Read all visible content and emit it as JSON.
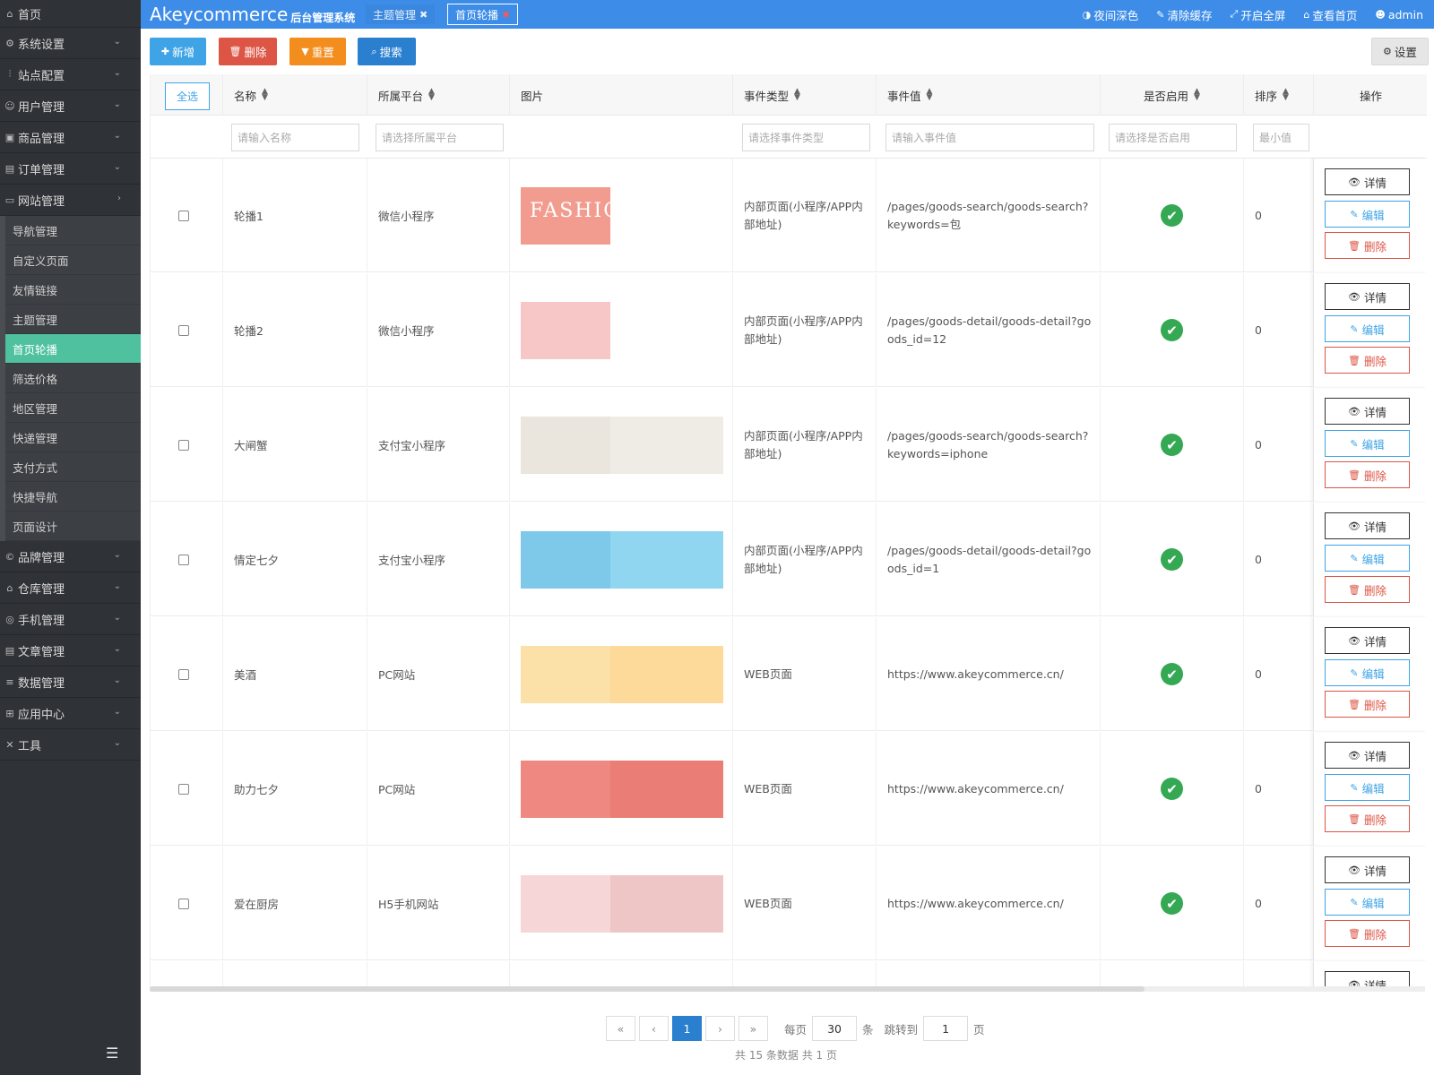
{
  "sidebar": {
    "home": "首页",
    "items_before": [
      {
        "label": "系统设置",
        "icon": "gear-icon",
        "glyph": "⚙"
      },
      {
        "label": "站点配置",
        "icon": "sliders-icon",
        "glyph": "⫶"
      },
      {
        "label": "用户管理",
        "icon": "user-icon",
        "glyph": "☺"
      },
      {
        "label": "商品管理",
        "icon": "box-icon",
        "glyph": "▣"
      },
      {
        "label": "订单管理",
        "icon": "list-icon",
        "glyph": "▤"
      },
      {
        "label": "网站管理",
        "icon": "monitor-icon",
        "glyph": "▭"
      }
    ],
    "submenu": [
      "导航管理",
      "自定义页面",
      "友情链接",
      "主题管理",
      "首页轮播",
      "筛选价格",
      "地区管理",
      "快递管理",
      "支付方式",
      "快捷导航",
      "页面设计"
    ],
    "active_sub": "首页轮播",
    "items_after": [
      {
        "label": "品牌管理",
        "icon": "copyright-icon",
        "glyph": "©"
      },
      {
        "label": "仓库管理",
        "icon": "warehouse-icon",
        "glyph": "⌂"
      },
      {
        "label": "手机管理",
        "icon": "mobile-icon",
        "glyph": "◎"
      },
      {
        "label": "文章管理",
        "icon": "article-icon",
        "glyph": "▤"
      },
      {
        "label": "数据管理",
        "icon": "database-icon",
        "glyph": "≡"
      },
      {
        "label": "应用中心",
        "icon": "apps-icon",
        "glyph": "⊞"
      },
      {
        "label": "工具",
        "icon": "tools-icon",
        "glyph": "✕"
      }
    ]
  },
  "topbar": {
    "brand": "Akeycommerce",
    "brand_sub": "后台管理系统",
    "tabs": [
      {
        "label": "主题管理"
      },
      {
        "label": "首页轮播"
      }
    ],
    "actions": [
      {
        "label": "夜间深色",
        "icon": "contrast-icon",
        "glyph": "◑"
      },
      {
        "label": "清除缓存",
        "icon": "brush-icon",
        "glyph": "✎"
      },
      {
        "label": "开启全屏",
        "icon": "fullscreen-icon",
        "glyph": "⤢"
      },
      {
        "label": "查看首页",
        "icon": "home-icon",
        "glyph": "⌂"
      },
      {
        "label": "admin",
        "icon": "user-icon",
        "glyph": "☻"
      }
    ]
  },
  "toolbar": {
    "add": "新增",
    "delete": "删除",
    "reset": "重置",
    "search": "搜索",
    "settings": "设置"
  },
  "table": {
    "select_all": "全选",
    "columns": {
      "name": "名称",
      "platform": "所属平台",
      "image": "图片",
      "event_type": "事件类型",
      "event_value": "事件值",
      "enabled": "是否启用",
      "sort": "排序",
      "ops": "操作"
    },
    "filters": {
      "name": "请输入名称",
      "platform": "请选择所属平台",
      "event_type": "请选择事件类型",
      "event_value": "请输入事件值",
      "enabled": "请选择是否启用",
      "sort_min": "最小值"
    },
    "op_labels": {
      "detail": "详情",
      "edit": "编辑",
      "delete": "删除"
    },
    "rows": [
      {
        "name": "轮播1",
        "platform": "微信小程序",
        "event_type": "内部页面(小程序/APP内部地址)",
        "event_value": "/pages/goods-search/goods-search?keywords=包",
        "sort": "0",
        "image_text": "FASHION",
        "img_color": "#f29c8f",
        "img_bg": "#f29c8f",
        "img_full": false
      },
      {
        "name": "轮播2",
        "platform": "微信小程序",
        "event_type": "内部页面(小程序/APP内部地址)",
        "event_value": "/pages/goods-detail/goods-detail?goods_id=12",
        "sort": "0",
        "image_text": "",
        "img_color": "#f7c6c6",
        "img_bg": "#f7c6c6",
        "img_full": false
      },
      {
        "name": "大闸蟹",
        "platform": "支付宝小程序",
        "event_type": "内部页面(小程序/APP内部地址)",
        "event_value": "/pages/goods-search/goods-search?keywords=iphone",
        "sort": "0",
        "image_text": "",
        "img_color": "#e9e4dc",
        "img_bg": "#efece6",
        "img_full": true
      },
      {
        "name": "情定七夕",
        "platform": "支付宝小程序",
        "event_type": "内部页面(小程序/APP内部地址)",
        "event_value": "/pages/goods-detail/goods-detail?goods_id=1",
        "sort": "0",
        "image_text": "",
        "img_color": "#7cc6e8",
        "img_bg": "#91d6f0",
        "img_full": true
      },
      {
        "name": "美酒",
        "platform": "PC网站",
        "event_type": "WEB页面",
        "event_value": "https://www.akeycommerce.cn/",
        "sort": "0",
        "image_text": "",
        "img_color": "#fbe0a9",
        "img_bg": "#fdd99a",
        "img_full": true
      },
      {
        "name": "助力七夕",
        "platform": "PC网站",
        "event_type": "WEB页面",
        "event_value": "https://www.akeycommerce.cn/",
        "sort": "0",
        "image_text": "",
        "img_color": "#ef8a82",
        "img_bg": "#ea7e76",
        "img_full": true
      },
      {
        "name": "爱在厨房",
        "platform": "H5手机网站",
        "event_type": "WEB页面",
        "event_value": "https://www.akeycommerce.cn/",
        "sort": "0",
        "image_text": "",
        "img_color": "#f6d7d7",
        "img_bg": "#eec6c6",
        "img_full": true
      },
      {
        "name": "",
        "platform": "",
        "event_type": "",
        "event_value": "",
        "sort": "",
        "image_text": "",
        "img_color": "#eeeeee",
        "img_bg": "#f4f4f4",
        "img_full": true
      }
    ]
  },
  "pagination": {
    "first": "«",
    "prev": "‹",
    "current": "1",
    "next": "›",
    "last": "»",
    "per_page_label": "每页",
    "per_page_value": "30",
    "per_page_unit": "条",
    "jump_label": "跳转到",
    "jump_value": "1",
    "jump_unit": "页",
    "summary": "共 15 条数据   共 1 页"
  },
  "colors": {
    "accent": "#3c8ce8",
    "sidebar_bg": "#2f3236",
    "active_menu": "#4fc19e",
    "enabled_green": "#34a853"
  }
}
